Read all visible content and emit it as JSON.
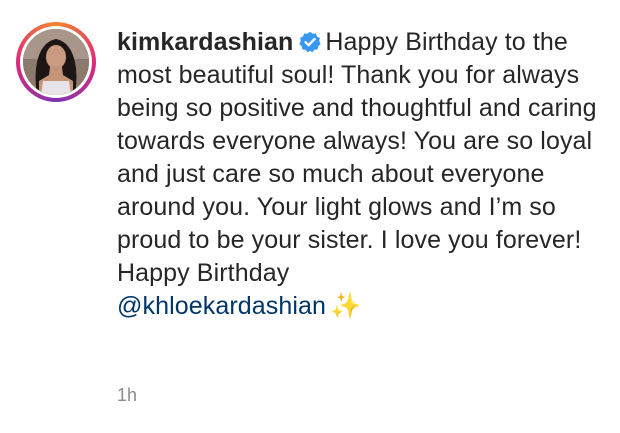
{
  "comment": {
    "username": "kimkardashian",
    "message": "Happy Birthday to the most beautiful soul! Thank you for always being so positive and thoughtful and caring towards everyone always! You are so loyal and just care so much about everyone around you. Your light glows and I’m so proud to be your sister. I love you forever! Happy Birthday",
    "mention": "@khloekardashian",
    "emoji": "✨",
    "timestamp": "1h"
  },
  "colors": {
    "text": "#262626",
    "mention": "#003569",
    "timestamp": "#8e8e8e",
    "verified_badge": "#3897f0"
  },
  "icons": {
    "verified": "verified-badge-icon",
    "avatar": "profile-avatar"
  }
}
